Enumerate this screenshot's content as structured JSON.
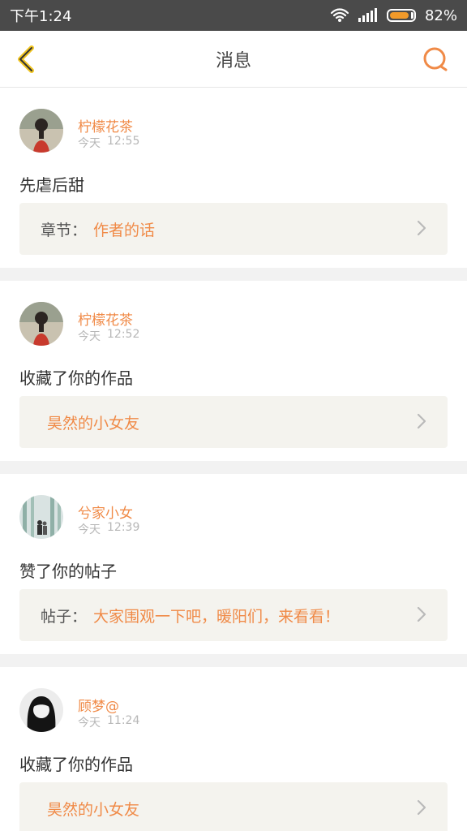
{
  "status_bar": {
    "time": "下午1:24",
    "battery_percent": "82%",
    "battery_level": 0.82
  },
  "header": {
    "title": "消息"
  },
  "messages": [
    {
      "username": "柠檬花茶",
      "day": "今天",
      "time": "12:55",
      "text": "先虐后甜",
      "link_label": "章节：",
      "link_target": "作者的话",
      "avatar_icon": "avatar-girl-red"
    },
    {
      "username": "柠檬花茶",
      "day": "今天",
      "time": "12:52",
      "text": "收藏了你的作品",
      "link_label": "",
      "link_target": "昊然的小女友",
      "avatar_icon": "avatar-girl-red"
    },
    {
      "username": "兮家小女",
      "day": "今天",
      "time": "12:39",
      "text": "赞了你的帖子",
      "link_label": "帖子：",
      "link_target": "大家围观一下吧，暖阳们，来看看！",
      "avatar_icon": "avatar-forest-couple"
    },
    {
      "username": "顾梦@",
      "day": "今天",
      "time": "11:24",
      "text": "收藏了你的作品",
      "link_label": "",
      "link_target": "昊然的小女友",
      "avatar_icon": "avatar-girl-black-hair"
    }
  ],
  "colors": {
    "accent": "#f08a47",
    "title": "#444444",
    "link_box_bg": "#f4f3ee"
  }
}
